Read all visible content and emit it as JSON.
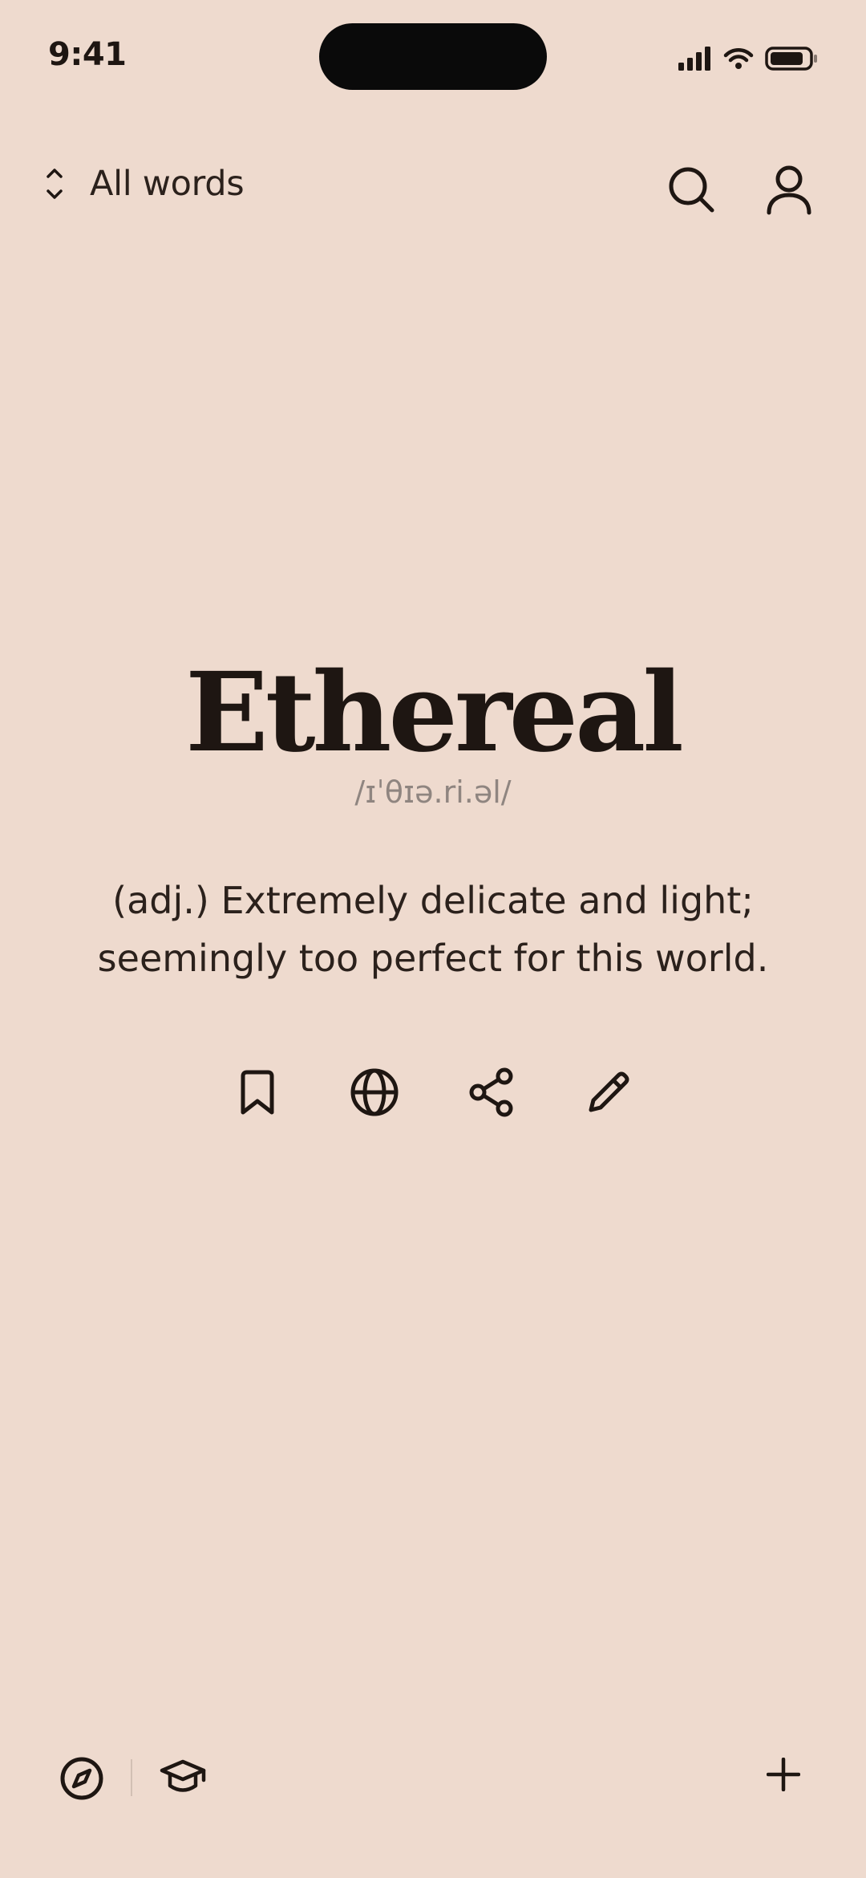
{
  "status_bar": {
    "time": "9:41"
  },
  "header": {
    "filter_label": "All words",
    "icons": [
      "chevron-up-down-icon",
      "search-icon",
      "profile-icon"
    ]
  },
  "word_card": {
    "word": "Ethereal",
    "pronunciation": "/ɪˈθɪə.ri.əl/",
    "definition": "(adj.) Extremely delicate and light; seemingly too perfect for this world.",
    "actions": [
      "bookmark-icon",
      "globe-icon",
      "share-icon",
      "pencil-icon"
    ]
  },
  "bottom_bar": {
    "icons": [
      "compass-icon",
      "graduation-cap-icon",
      "plus-icon"
    ]
  },
  "colors": {
    "background": "#EEDACE",
    "text_primary": "#1E1612",
    "text_muted": "#8F8580",
    "divider": "#D2C0B4"
  }
}
